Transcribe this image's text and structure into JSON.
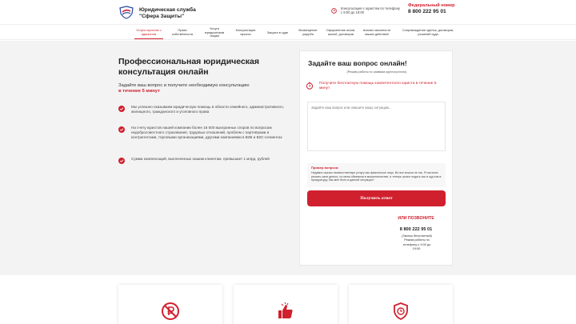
{
  "header": {
    "brand": "Юридическая служба \"Сфера Защиты\"",
    "hours_text": "Консультация с юристом по телефону с 9:00 до 19:00",
    "federal_label": "Федеральный номер",
    "phone": "8 800 222 95 01"
  },
  "nav": [
    {
      "label": "Услуги юристов о адвокатов",
      "active": true
    },
    {
      "label": "Право собственности",
      "active": false
    },
    {
      "label": "Услуги юридическим лицам",
      "active": false
    },
    {
      "label": "Консультация юриста",
      "active": false
    },
    {
      "label": "Защита в суде",
      "active": false
    },
    {
      "label": "Возмещение ущерба",
      "active": false
    },
    {
      "label": "Оформление исков, жалоб, договоров",
      "active": false
    },
    {
      "label": "Анализ законности ваших действий",
      "active": false
    },
    {
      "label": "Сопровождение сделок, договоров, решений суда",
      "active": false
    }
  ],
  "hero": {
    "title": "Профессиональная юридическая консультация онлайн",
    "subtitle": "Задайте ваш вопрос и получите необходимую консультацию",
    "subtitle_accent": "в течение 5 минут",
    "bullets": [
      "Мы успешно оказываем юридическую помощь в области семейного, административного, жилищного, гражданского и уголовного права",
      "На счету юристов нашей компании более 16 000 выигранных споров по вопросам недобросовестного страхования, трудовых отношений, проблем с партнёрами и контрагентами, торговыми организациями, другими компаниями в B2B и B2C-сегментах",
      "Сумма компенсаций, выплаченных нашим клиентам, превышает 1 млрд. рублей"
    ]
  },
  "form": {
    "title": "Задайте ваш вопрос онлайн!",
    "note": "(Режим работы по заявкам круглосуточно)",
    "promo": "Получите бесплатную помощь компетентного юриста в течение 5 минут",
    "placeholder": "Задайте ваш вопрос или опишите вашу ситуацию...",
    "example_head": "Пример вопроса:",
    "example_body": "Недавно оказал некачественную услугу как физическое лицо. Во все вошли не так. Я пытался решить свои деньги, но меня обвинили в мошенничестве, и теперь грозит подать иск в суд или в прокуратуру. Как мне быть в данной ситуации?",
    "submit": "Получить ответ",
    "or_call": "ИЛИ ПОЗВОНИТЕ",
    "phone": "8 800 222 95 01",
    "free_text": "(Звонок бесплатный) Режим работы по телефону с 9:00 до 19:00."
  },
  "features": [
    {
      "icon": "no-ruble-icon"
    },
    {
      "icon": "thumbs-up-icon"
    },
    {
      "icon": "shield-clock-icon"
    }
  ],
  "colors": {
    "accent": "#d0202e",
    "bg": "#f3f3f3"
  }
}
